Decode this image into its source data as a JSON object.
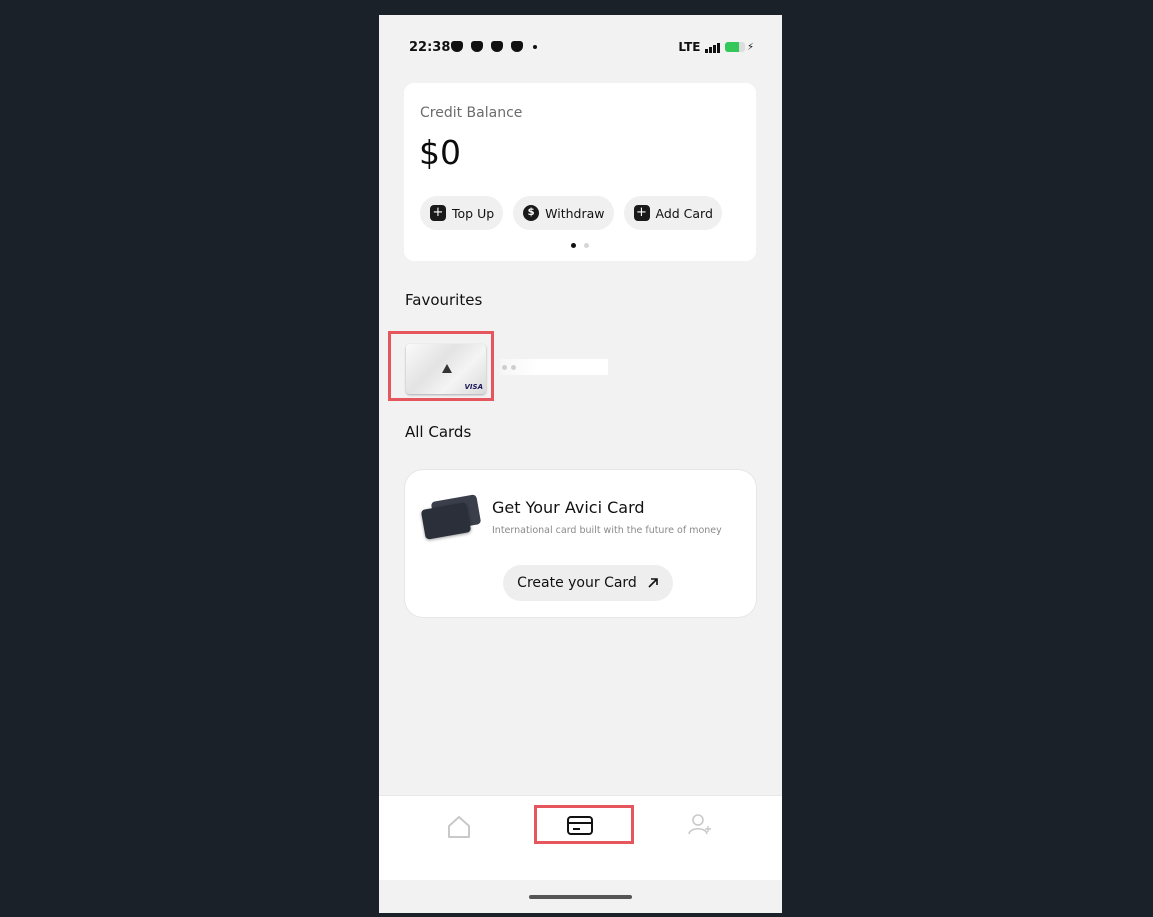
{
  "status_bar": {
    "time": "22:38",
    "network": "LTE",
    "signal_bars": 4,
    "battery_level": 0.7
  },
  "balance": {
    "label": "Credit Balance",
    "value": "$0",
    "actions": [
      {
        "label": "Top Up",
        "icon": "plus-icon"
      },
      {
        "label": "Withdraw",
        "icon": "dollar-icon"
      },
      {
        "label": "Add Card",
        "icon": "plus-icon"
      }
    ],
    "page_count": 2,
    "active_page": 1
  },
  "favourites": {
    "title": "Favourites",
    "card_brand": "VISA"
  },
  "all_cards": {
    "title": "All Cards"
  },
  "promo": {
    "title": "Get Your Avici Card",
    "subtitle": "International card built with the future of money",
    "button_label": "Create your Card",
    "button_icon": "arrow-up-right-icon"
  },
  "bottom_nav": {
    "items": [
      {
        "name": "home",
        "icon": "home-icon",
        "active": false
      },
      {
        "name": "cards",
        "icon": "card-icon",
        "active": true
      },
      {
        "name": "profile",
        "icon": "profile-icon",
        "active": false
      }
    ]
  },
  "colors": {
    "background": "#1b2129",
    "highlight": "#e5575c",
    "battery": "#34c759"
  }
}
